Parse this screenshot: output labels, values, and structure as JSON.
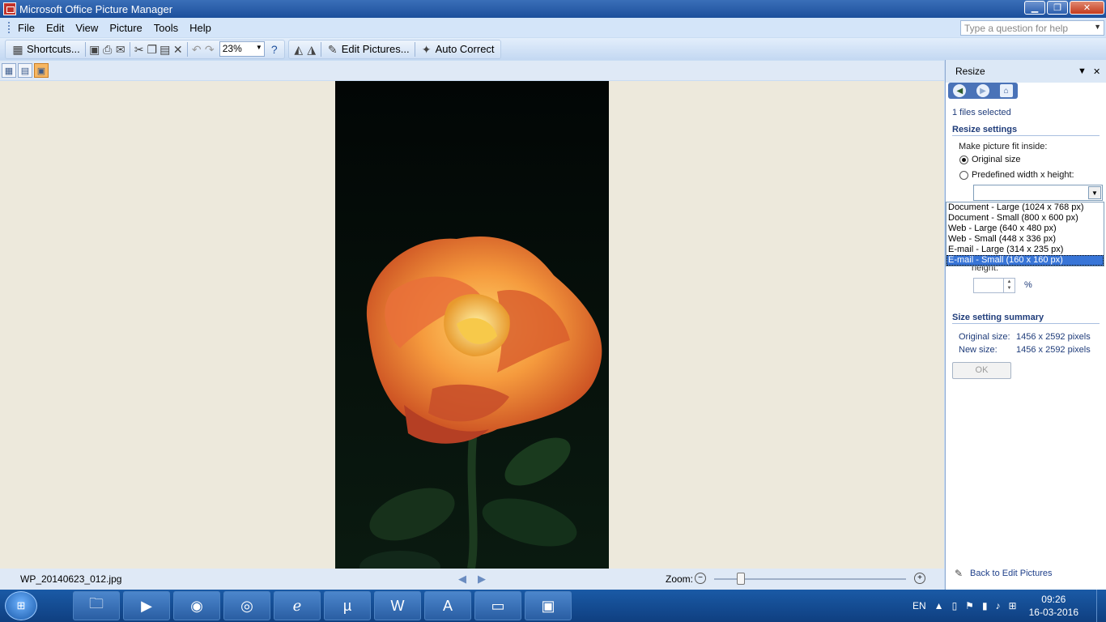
{
  "window": {
    "title": "Microsoft Office Picture Manager"
  },
  "menu": {
    "items": [
      "File",
      "Edit",
      "View",
      "Picture",
      "Tools",
      "Help"
    ]
  },
  "help": {
    "placeholder": "Type a question for help"
  },
  "toolbar": {
    "shortcuts_label": "Shortcuts...",
    "zoom_value": "23%",
    "edit_pictures_label": "Edit Pictures...",
    "auto_correct_label": "Auto Correct"
  },
  "status": {
    "filename": "WP_20140623_012.jpg",
    "zoom_label": "Zoom:"
  },
  "taskpane": {
    "title": "Resize",
    "files_selected": "1 files selected",
    "resize_settings_heading": "Resize settings",
    "fit_inside_label": "Make picture fit inside:",
    "original_size_label": "Original size",
    "predefined_label": "Predefined width x height:",
    "dropdown_options": [
      "Document - Large (1024 x 768 px)",
      "Document - Small (800 x 600 px)",
      "Web - Large (640 x 480 px)",
      "Web - Small (448 x 336 px)",
      "E-mail - Large (314 x 235 px)",
      "E-mail - Small (160 x 160 px)"
    ],
    "height_label": "height:",
    "percent_symbol": "%",
    "summary_heading": "Size setting summary",
    "original_size_key": "Original size:",
    "original_size_value": "1456 x 2592 pixels",
    "new_size_key": "New size:",
    "new_size_value": "1456 x 2592 pixels",
    "ok_label": "OK",
    "back_link": "Back to Edit Pictures"
  },
  "taskbar": {
    "apps": [
      "file-explorer",
      "media-player",
      "firefox",
      "chrome",
      "internet-explorer",
      "utorrent",
      "word",
      "acrobat",
      "photo-viewer",
      "picture-manager"
    ],
    "language": "EN",
    "time": "09:26",
    "date": "16-03-2016"
  }
}
